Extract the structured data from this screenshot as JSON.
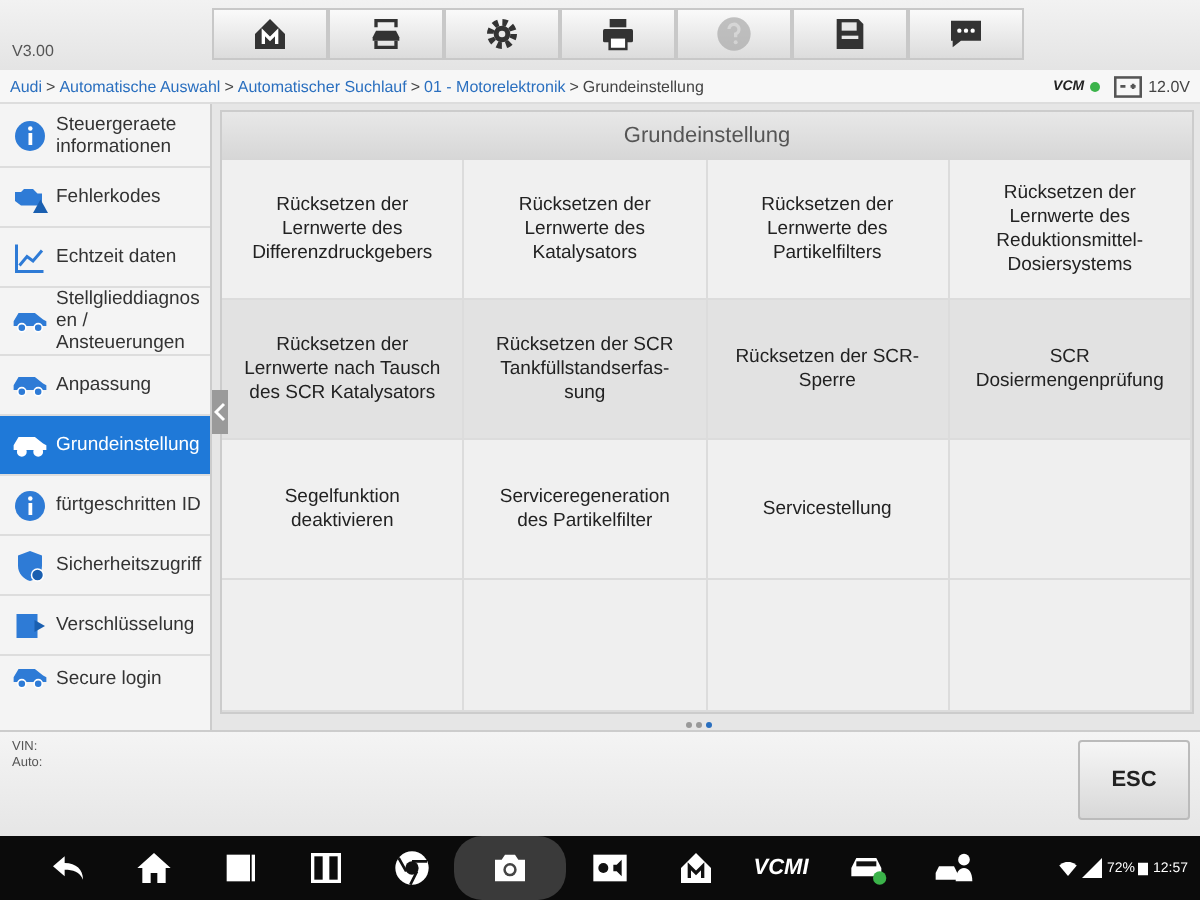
{
  "header": {
    "version": "V3.00",
    "toolbar": [
      {
        "disabled": false
      },
      {
        "disabled": false
      },
      {
        "disabled": false
      },
      {
        "disabled": false
      },
      {
        "disabled": true
      },
      {
        "disabled": false
      },
      {
        "disabled": false
      }
    ]
  },
  "breadcrumb": {
    "links": [
      "Audi",
      "Automatische Auswahl",
      "Automatischer Suchlauf",
      "01 - Motorelektronik"
    ],
    "current": "Grundeinstellung",
    "separator": ">",
    "vcm_label": "VCM",
    "voltage": "12.0V"
  },
  "sidebar": {
    "items": [
      {
        "label": "Steuergeraete informationen",
        "selected": false
      },
      {
        "label": "Fehlerkodes",
        "selected": false
      },
      {
        "label": "Echtzeit daten",
        "selected": false
      },
      {
        "label": "Stellglieddiagnos en / Ansteuerungen",
        "selected": false
      },
      {
        "label": "Anpassung",
        "selected": false
      },
      {
        "label": "Grundeinstellung",
        "selected": true
      },
      {
        "label": "fürtgeschritten ID",
        "selected": false
      },
      {
        "label": "Sicherheitszugriff",
        "selected": false
      },
      {
        "label": "Verschlüsselung",
        "selected": false
      },
      {
        "label": "Secure login",
        "selected": false
      }
    ]
  },
  "panel": {
    "title": "Grundeinstellung",
    "functions": [
      "Rücksetzen der Lernwerte des Differenzdruckgebers",
      "Rücksetzen der Lernwerte des Katalysators",
      "Rücksetzen der Lernwerte des Partikelfilters",
      "Rücksetzen der Lernwerte des Reduktionsmittel-Dosiersystems",
      "Rücksetzen der Lernwerte nach Tausch des SCR Katalysators",
      "Rücksetzen der SCR Tankfüllstandserfas-sung",
      "Rücksetzen der SCR-Sperre",
      "SCR Dosiermengenprüfung",
      "Segelfunktion deaktivieren",
      "Serviceregeneration des Partikelfilter",
      "Servicestellung"
    ]
  },
  "info_bar": {
    "vin_label": "VIN:",
    "auto_label": "Auto:",
    "esc_button": "ESC"
  },
  "nav_bar": {
    "vcm_label": "VCMI",
    "battery": "72%",
    "time": "12:57"
  }
}
